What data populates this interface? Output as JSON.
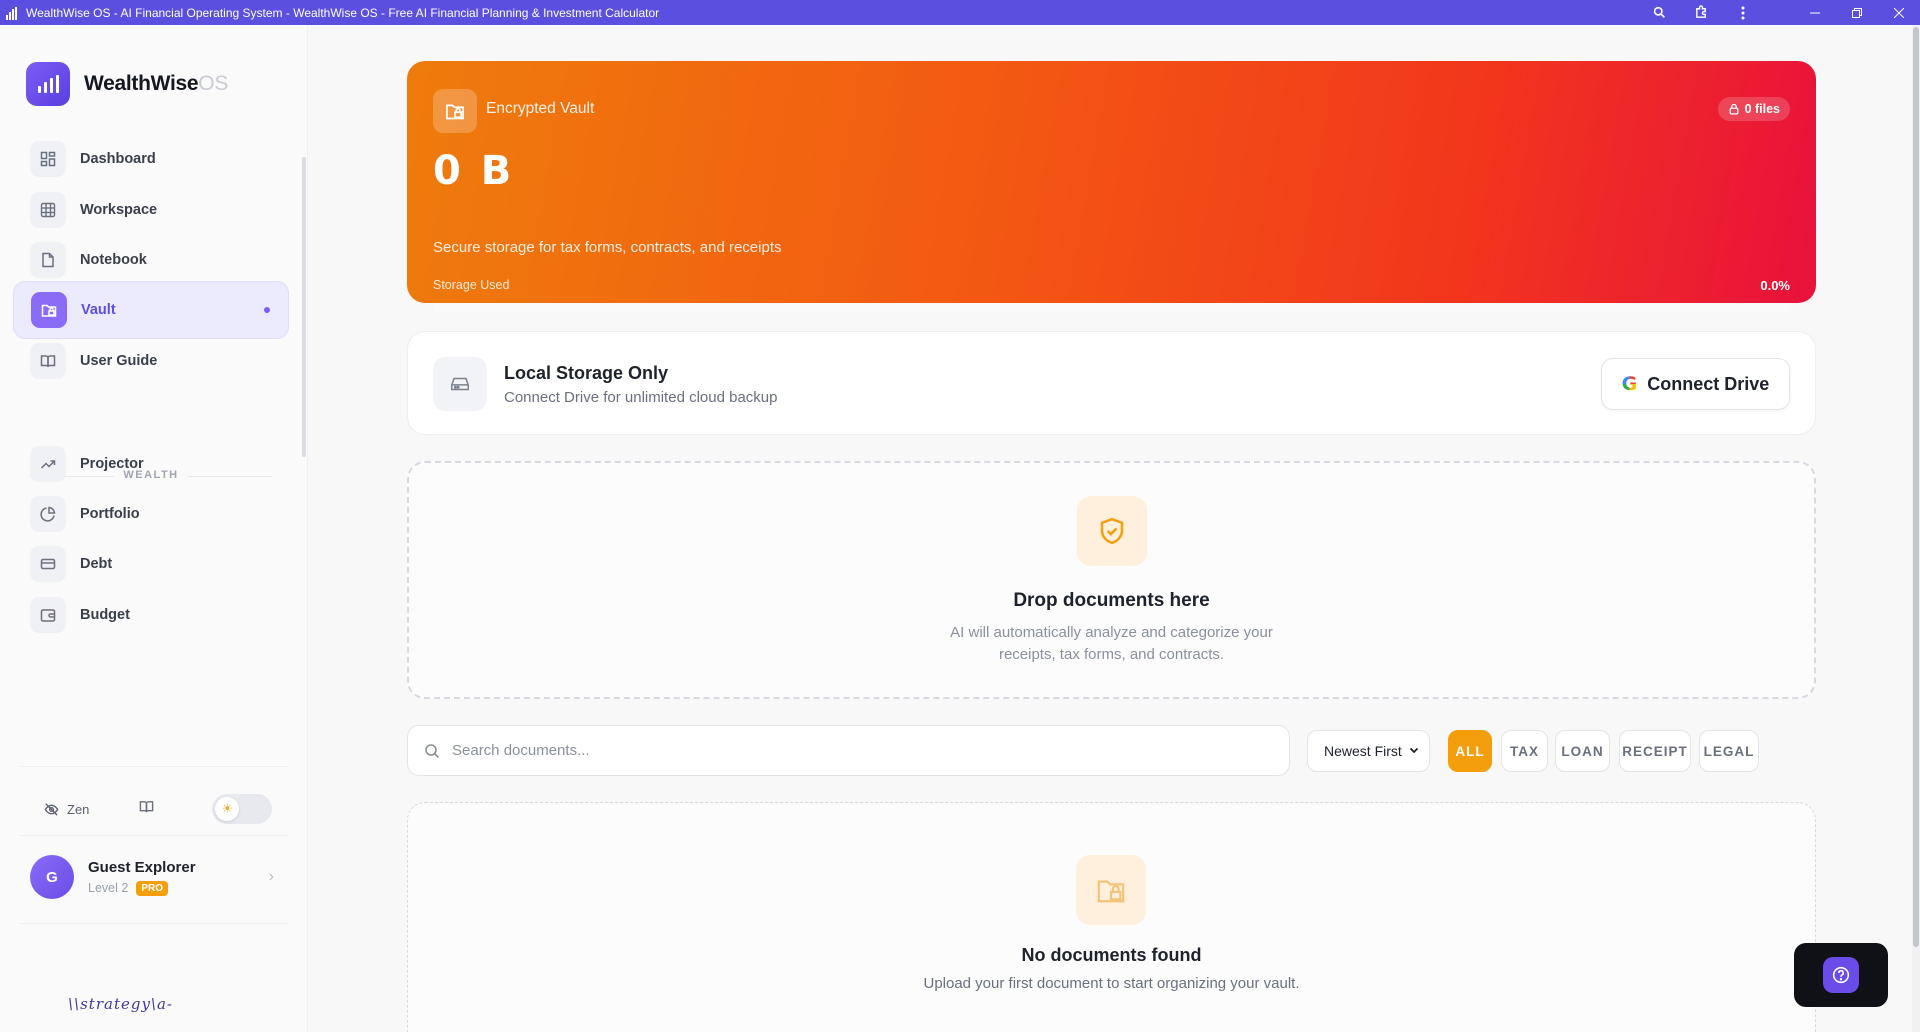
{
  "window": {
    "title": "WealthWise OS - AI Financial Operating System - WealthWise OS - Free AI Financial Planning & Investment Calculator"
  },
  "brand": {
    "name": "WealthWise",
    "suffix": "OS"
  },
  "sidebar": {
    "items": [
      {
        "label": "Dashboard",
        "icon": "dashboard-icon"
      },
      {
        "label": "Workspace",
        "icon": "grid-icon"
      },
      {
        "label": "Notebook",
        "icon": "file-icon"
      },
      {
        "label": "Vault",
        "icon": "folder-lock-icon",
        "active": true
      },
      {
        "label": "User Guide",
        "icon": "book-icon"
      }
    ],
    "section_label": "WEALTH",
    "wealth_items": [
      {
        "label": "Projector",
        "icon": "trending-up-icon"
      },
      {
        "label": "Portfolio",
        "icon": "pie-chart-icon"
      },
      {
        "label": "Debt",
        "icon": "credit-card-icon"
      },
      {
        "label": "Budget",
        "icon": "wallet-icon"
      }
    ],
    "zen_label": "Zen",
    "theme": "light",
    "user": {
      "initial": "G",
      "name": "Guest Explorer",
      "level": "Level 2",
      "badge": "PRO"
    },
    "signature": "\\\\strategy\\a-"
  },
  "vault": {
    "label": "Encrypted Vault",
    "files": "0 files",
    "size": "0 B",
    "description": "Secure storage for tax forms, contracts, and receipts",
    "storage_label": "Storage Used",
    "storage_pct_text": "0.0%",
    "storage_fraction": 0.0
  },
  "storage": {
    "title": "Local Storage Only",
    "subtitle": "Connect Drive for unlimited cloud backup",
    "connect_label": "Connect Drive",
    "google_letter": "G"
  },
  "dropzone": {
    "title": "Drop documents here",
    "subtitle": "AI will automatically analyze and categorize your receipts, tax forms, and contracts."
  },
  "search": {
    "placeholder": "Search documents...",
    "sort_value": "Newest First",
    "filters": [
      "ALL",
      "TAX",
      "LOAN",
      "RECEIPT",
      "LEGAL"
    ],
    "active_filter": "ALL"
  },
  "documents": {
    "empty_title": "No documents found",
    "empty_subtitle": "Upload your first document to start organizing your vault."
  },
  "colors": {
    "accent": "#5b4fe0",
    "vault_gradient_start": "#ee7c0c",
    "vault_gradient_end": "#e8113c",
    "filter_active": "#f59e0b"
  }
}
